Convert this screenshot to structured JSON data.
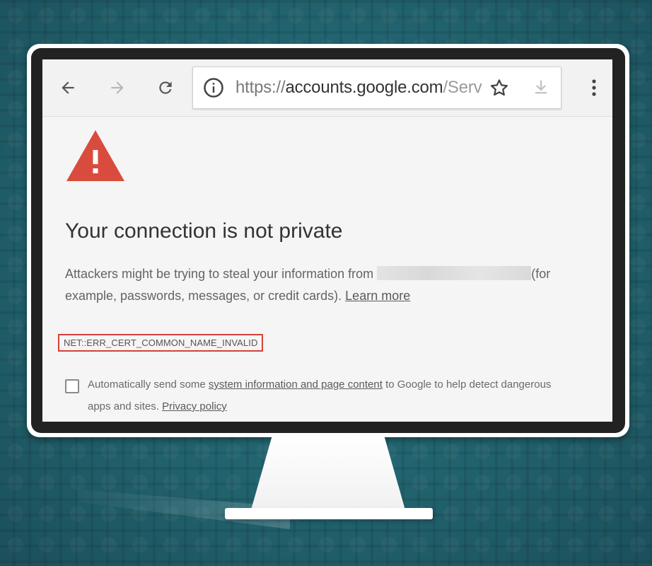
{
  "browser": {
    "url_scheme": "https://",
    "url_host": "accounts.google.com",
    "url_path": "/Serv"
  },
  "page": {
    "title": "Your connection is not private",
    "desc_part1": "Attackers might be trying to steal your information from",
    "desc_part2": "(for example, passwords, messages, or credit cards).",
    "learn_more": "Learn more",
    "error_code": "NET::ERR_CERT_COMMON_NAME_INVALID",
    "checkbox_text_1": "Automatically send some",
    "checkbox_link": "system information and page content",
    "checkbox_text_2": "to Google to help detect dangerous apps and sites.",
    "privacy_link": "Privacy policy"
  },
  "colors": {
    "warning_red": "#d94c3d",
    "error_box": "#d5403a",
    "background_teal": "#155a66"
  },
  "icons": [
    "back-arrow-icon",
    "forward-arrow-icon",
    "reload-icon",
    "info-icon",
    "star-icon",
    "download-icon",
    "menu-dots-icon",
    "warning-triangle-icon"
  ]
}
